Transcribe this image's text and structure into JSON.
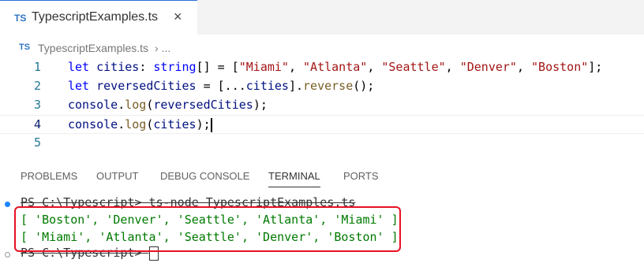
{
  "tab": {
    "icon": "TS",
    "label": "TypescriptExamples.ts",
    "close": "×"
  },
  "breadcrumb": {
    "icon": "TS",
    "file": "TypescriptExamples.ts",
    "sep": "› ..."
  },
  "editor": {
    "lines": [
      {
        "number": "1"
      },
      {
        "number": "2"
      },
      {
        "number": "3"
      },
      {
        "number": "4"
      },
      {
        "number": "5"
      }
    ],
    "tokens": {
      "l1": [
        "let",
        " ",
        "cities",
        ": ",
        "string",
        "[] = [",
        "\"Miami\"",
        ", ",
        "\"Atlanta\"",
        ", ",
        "\"Seattle\"",
        ", ",
        "\"Denver\"",
        ", ",
        "\"Boston\"",
        "];"
      ],
      "l2": [
        "let",
        " ",
        "reversedCities",
        " = [...",
        "cities",
        "].",
        "reverse",
        "();"
      ],
      "l3": [
        "console",
        ".",
        "log",
        "(",
        "reversedCities",
        ");"
      ],
      "l4": [
        "console",
        ".",
        "log",
        "(",
        "cities",
        ");"
      ]
    }
  },
  "panel": {
    "tabs": [
      "PROBLEMS",
      "OUTPUT",
      "DEBUG CONSOLE",
      "TERMINAL",
      "PORTS"
    ],
    "active": "TERMINAL"
  },
  "terminal": {
    "prompt1": "PS C:\\Typescript> ts-node TypescriptExamples.ts",
    "out1": "[ 'Boston', 'Denver', 'Seattle', 'Atlanta', 'Miami' ]",
    "out2": "[ 'Miami', 'Atlanta', 'Seattle', 'Denver', 'Boston' ]",
    "prompt2": "PS C:\\Typescript> "
  },
  "colors": {
    "highlight": "#e81123",
    "accent": "#2b6fd6"
  }
}
